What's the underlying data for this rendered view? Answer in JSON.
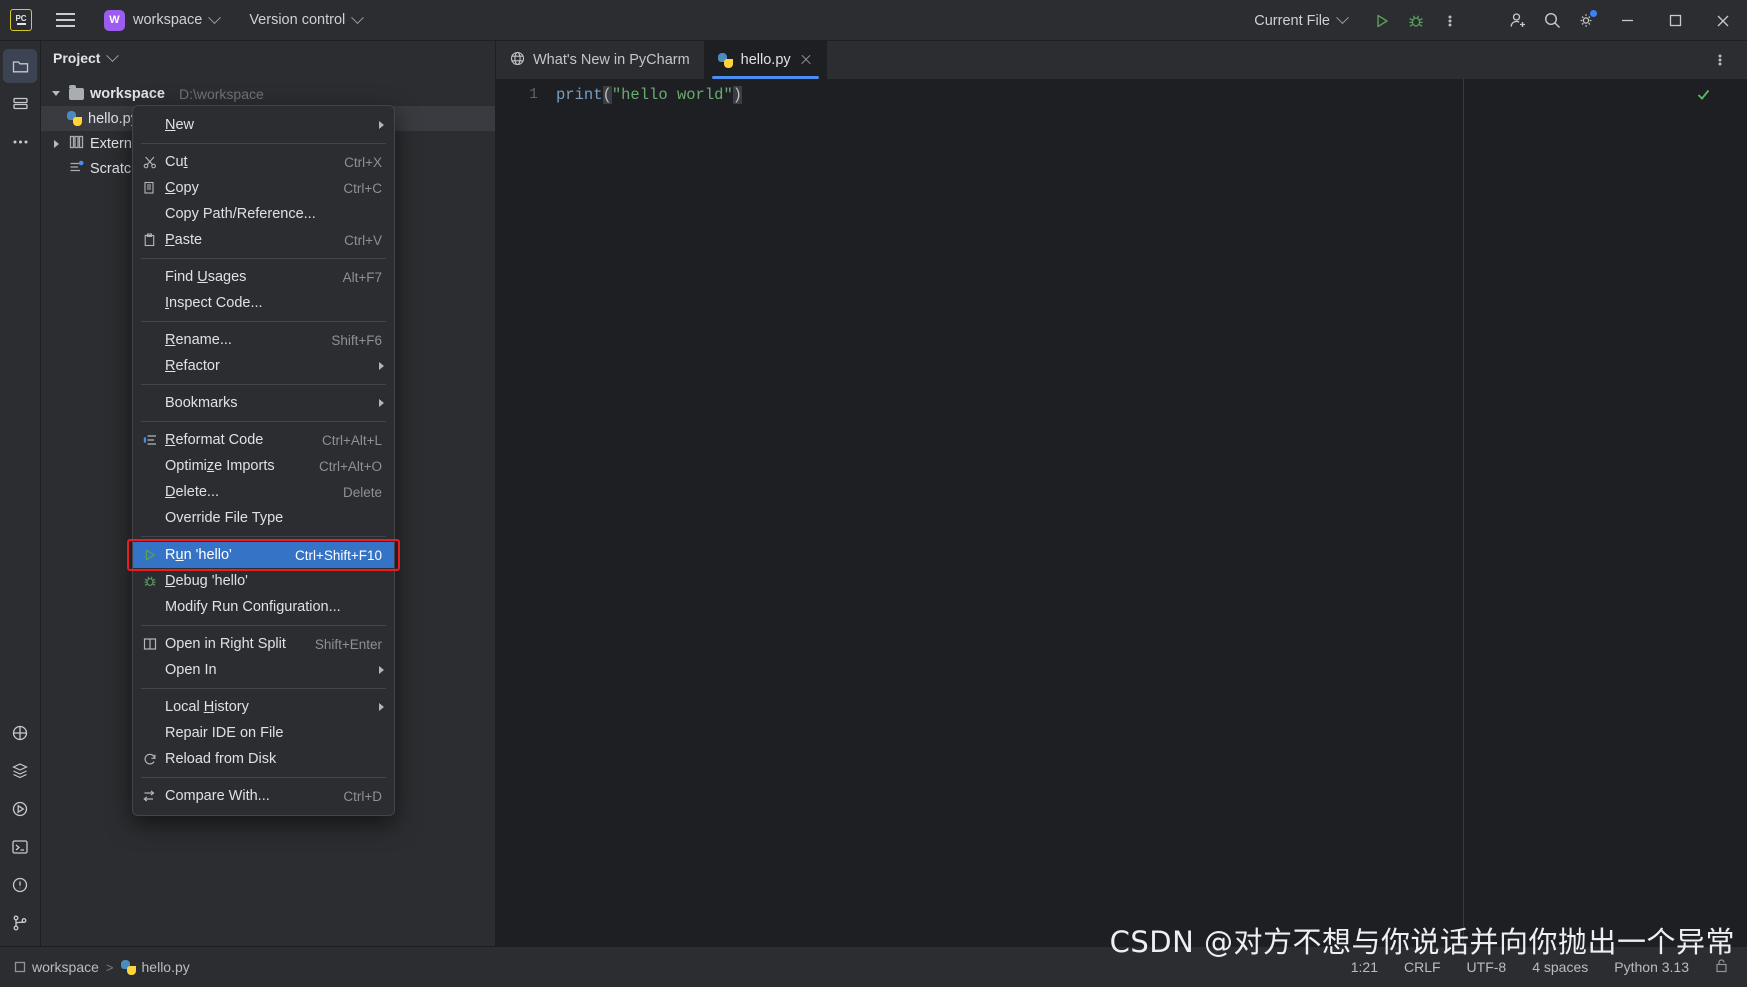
{
  "titlebar": {
    "logo_text": "PC",
    "hamburger_icon": "hamburger-menu-icon",
    "workspace_badge": "W",
    "workspace_name": "workspace",
    "version_control": "Version control",
    "run_config": "Current File",
    "run_icon": "run-play-icon",
    "debug_icon": "debug-bug-icon",
    "more_icon": "more-vertical-icon",
    "account_icon": "add-account-icon",
    "search_icon": "search-icon",
    "settings_icon": "gear-icon",
    "minimize_icon": "minimize-icon",
    "maximize_icon": "maximize-icon",
    "close_icon": "close-icon"
  },
  "rail": {
    "items": [
      {
        "name": "project-tool-icon",
        "glyph": "folder"
      },
      {
        "name": "commit-tool-icon",
        "glyph": "commit"
      },
      {
        "name": "more-tool-icon",
        "glyph": "dots"
      }
    ],
    "bottom_items": [
      {
        "name": "python-packages-icon",
        "glyph": "py"
      },
      {
        "name": "database-icon",
        "glyph": "db"
      },
      {
        "name": "services-icon",
        "glyph": "play-circle"
      },
      {
        "name": "terminal-icon",
        "glyph": "terminal"
      },
      {
        "name": "problems-icon",
        "glyph": "warning"
      },
      {
        "name": "version-control-icon",
        "glyph": "branch"
      }
    ]
  },
  "project_panel": {
    "title": "Project",
    "tree": [
      {
        "label": "workspace",
        "path": "D:\\workspace",
        "bold": true,
        "twist": "down",
        "icon": "folder-icon",
        "indent": 0,
        "selected": false
      },
      {
        "label": "hello.py",
        "path": "",
        "bold": false,
        "twist": "none",
        "icon": "python-file-icon",
        "indent": 1,
        "selected": true
      },
      {
        "label": "External Libraries",
        "path": "",
        "bold": false,
        "twist": "right",
        "icon": "library-icon",
        "indent": 0,
        "selected": false
      },
      {
        "label": "Scratches and Consoles",
        "path": "",
        "bold": false,
        "twist": "none",
        "icon": "scratch-icon",
        "indent": 0,
        "selected": false
      }
    ]
  },
  "editor": {
    "tabs": [
      {
        "label": "What's New in PyCharm",
        "icon": "globe-icon",
        "active": false,
        "closable": false
      },
      {
        "label": "hello.py",
        "icon": "python-file-icon",
        "active": true,
        "closable": true
      }
    ],
    "options_icon": "more-vertical-icon",
    "line_numbers": [
      "1"
    ],
    "code_tokens": [
      {
        "text": "print",
        "type": "function"
      },
      {
        "text": "(",
        "type": "paren"
      },
      {
        "text": "\"hello world\"",
        "type": "string"
      },
      {
        "text": ")",
        "type": "paren"
      }
    ],
    "inspection_icon": "checkmark-icon"
  },
  "context_menu": {
    "items": [
      {
        "label": "New",
        "mnemonic": "N",
        "shortcut": "",
        "icon": "",
        "submenu": true,
        "highlight": false
      },
      {
        "separator": true
      },
      {
        "label": "Cut",
        "mnemonic": "t",
        "shortcut": "Ctrl+X",
        "icon": "scissors-icon",
        "submenu": false,
        "highlight": false
      },
      {
        "label": "Copy",
        "mnemonic": "C",
        "shortcut": "Ctrl+C",
        "icon": "copy-icon",
        "submenu": false,
        "highlight": false
      },
      {
        "label": "Copy Path/Reference...",
        "mnemonic": "",
        "shortcut": "",
        "icon": "",
        "submenu": false,
        "highlight": false
      },
      {
        "label": "Paste",
        "mnemonic": "P",
        "shortcut": "Ctrl+V",
        "icon": "paste-icon",
        "submenu": false,
        "highlight": false
      },
      {
        "separator": true
      },
      {
        "label": "Find Usages",
        "mnemonic": "U",
        "shortcut": "Alt+F7",
        "icon": "",
        "submenu": false,
        "highlight": false
      },
      {
        "label": "Inspect Code...",
        "mnemonic": "I",
        "shortcut": "",
        "icon": "",
        "submenu": false,
        "highlight": false
      },
      {
        "separator": true
      },
      {
        "label": "Rename...",
        "mnemonic": "R",
        "shortcut": "Shift+F6",
        "icon": "",
        "submenu": false,
        "highlight": false
      },
      {
        "label": "Refactor",
        "mnemonic": "R",
        "shortcut": "",
        "icon": "",
        "submenu": true,
        "highlight": false
      },
      {
        "separator": true
      },
      {
        "label": "Bookmarks",
        "mnemonic": "",
        "shortcut": "",
        "icon": "",
        "submenu": true,
        "highlight": false
      },
      {
        "separator": true
      },
      {
        "label": "Reformat Code",
        "mnemonic": "R",
        "shortcut": "Ctrl+Alt+L",
        "icon": "reformat-icon",
        "submenu": false,
        "highlight": false
      },
      {
        "label": "Optimize Imports",
        "mnemonic": "z",
        "shortcut": "Ctrl+Alt+O",
        "icon": "",
        "submenu": false,
        "highlight": false
      },
      {
        "label": "Delete...",
        "mnemonic": "D",
        "shortcut": "Delete",
        "icon": "",
        "submenu": false,
        "highlight": false
      },
      {
        "label": "Override File Type",
        "mnemonic": "",
        "shortcut": "",
        "icon": "",
        "submenu": false,
        "highlight": false
      },
      {
        "separator": true
      },
      {
        "label": "Run 'hello'",
        "mnemonic": "u",
        "shortcut": "Ctrl+Shift+F10",
        "icon": "run-play-icon",
        "submenu": false,
        "highlight": true
      },
      {
        "label": "Debug 'hello'",
        "mnemonic": "D",
        "shortcut": "",
        "icon": "debug-bug-icon",
        "submenu": false,
        "highlight": false
      },
      {
        "label": "Modify Run Configuration...",
        "mnemonic": "",
        "shortcut": "",
        "icon": "",
        "submenu": false,
        "highlight": false
      },
      {
        "separator": true
      },
      {
        "label": "Open in Right Split",
        "mnemonic": "",
        "shortcut": "Shift+Enter",
        "icon": "split-icon",
        "submenu": false,
        "highlight": false
      },
      {
        "label": "Open In",
        "mnemonic": "",
        "shortcut": "",
        "icon": "",
        "submenu": true,
        "highlight": false
      },
      {
        "separator": true
      },
      {
        "label": "Local History",
        "mnemonic": "H",
        "shortcut": "",
        "icon": "",
        "submenu": true,
        "highlight": false
      },
      {
        "label": "Repair IDE on File",
        "mnemonic": "",
        "shortcut": "",
        "icon": "",
        "submenu": false,
        "highlight": false
      },
      {
        "label": "Reload from Disk",
        "mnemonic": "",
        "shortcut": "",
        "icon": "reload-icon",
        "submenu": false,
        "highlight": false
      },
      {
        "separator": true
      },
      {
        "label": "Compare With...",
        "mnemonic": "",
        "shortcut": "Ctrl+D",
        "icon": "compare-icon",
        "submenu": false,
        "highlight": false
      }
    ],
    "highlight_color": "#3573c6",
    "annotation_box_color": "#ec1c24"
  },
  "statusbar": {
    "breadcrumb": [
      {
        "label": "workspace",
        "icon": "module-icon"
      },
      {
        "label": "hello.py",
        "icon": "python-file-icon"
      }
    ],
    "separator": ">",
    "caret_position": "1:21",
    "line_separator": "CRLF",
    "encoding": "UTF-8",
    "indent": "4 spaces",
    "interpreter": "Python 3.13",
    "lock_icon": "readonly-toggle-icon"
  },
  "watermark": {
    "text": "CSDN @对方不想与你说话并向你抛出一个异常"
  }
}
